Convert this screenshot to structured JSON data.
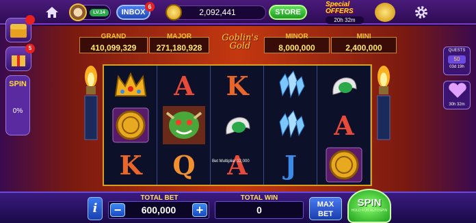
{
  "topbar": {
    "level": "LV.14",
    "inbox": {
      "label": "INBOX",
      "badge": "6"
    },
    "coins": "2,092,441",
    "store_label": "STORE",
    "offers": {
      "title": "Special OFFERS",
      "timer": "20h 32m"
    }
  },
  "jackpots": [
    {
      "label": "GRAND",
      "value": "410,099,329"
    },
    {
      "label": "MAJOR",
      "value": "271,180,928"
    },
    {
      "label": "MINOR",
      "value": "8,000,000"
    },
    {
      "label": "MINI",
      "value": "2,400,000"
    }
  ],
  "game_title": "Goblin's Gold",
  "bet_multiplier": "Bet Multiplier 12,000",
  "reels": [
    [
      {
        "symbol": "crown-icon"
      },
      {
        "symbol": "gold-coin-icon"
      },
      {
        "symbol": "K",
        "color": "#e8662a"
      }
    ],
    [
      {
        "symbol": "A",
        "color": "#e84a3a"
      },
      {
        "symbol": "goblin-icon"
      },
      {
        "symbol": "Q",
        "color": "#f09030"
      }
    ],
    [
      {
        "symbol": "K",
        "color": "#e8662a"
      },
      {
        "symbol": "emerald-claw-icon"
      },
      {
        "symbol": "A",
        "color": "#e84a3a"
      }
    ],
    [
      {
        "symbol": "crystal-icon"
      },
      {
        "symbol": "crystal-icon"
      },
      {
        "symbol": "J",
        "color": "#3a8ae8"
      }
    ],
    [
      {
        "symbol": "emerald-claw-icon"
      },
      {
        "symbol": "A",
        "color": "#e84a3a"
      },
      {
        "symbol": "gold-coin-icon"
      }
    ]
  ],
  "side_left": {
    "btn1_badge": "",
    "btn2_badge": "5",
    "spin_card": {
      "title": "SPIN",
      "percent": "0%"
    }
  },
  "side_right": {
    "quest": {
      "title": "QUESTS",
      "number": "50",
      "time": "03d 19h"
    },
    "heart_time": "30h 32m"
  },
  "bottom": {
    "total_bet_label": "TOTAL BET",
    "total_bet": "600,000",
    "total_win_label": "TOTAL WIN",
    "total_win": "0",
    "max_bet": "MAX BET",
    "spin": "SPIN",
    "spin_sub": "HOLD FOR AUTOSPIN"
  },
  "colors": {
    "accent": "#7a3cc4",
    "jackpot_gold": "#ffe870",
    "spin_green": "#1ea020"
  }
}
